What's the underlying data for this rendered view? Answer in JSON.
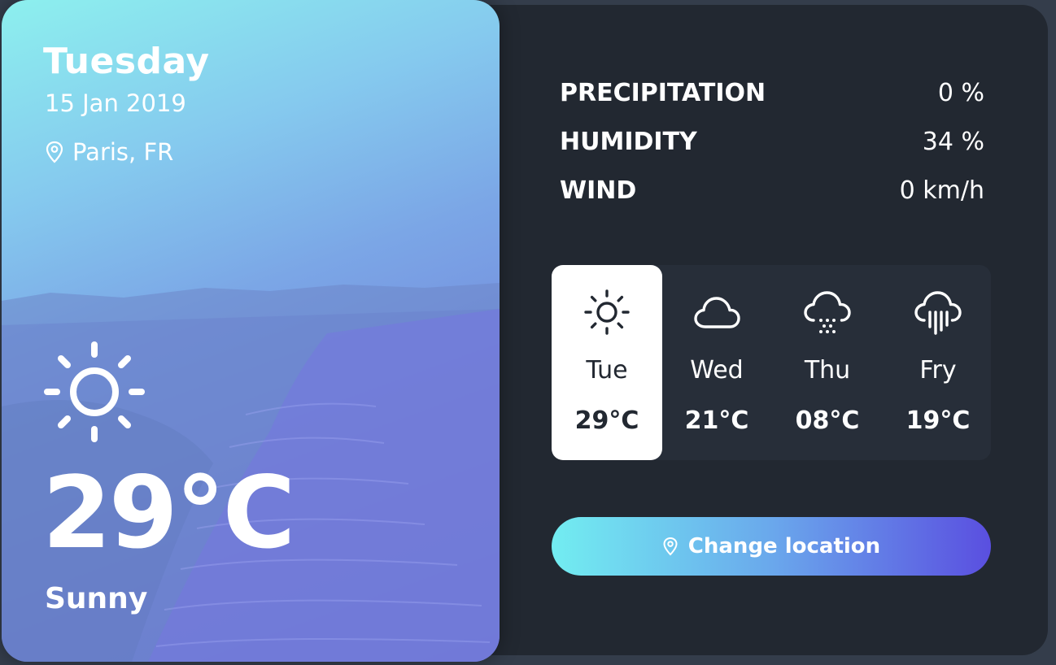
{
  "today": {
    "day": "Tuesday",
    "date": "15 Jan 2019",
    "location": "Paris, FR",
    "location_icon": "map-pin-icon",
    "temperature": "29°C",
    "condition": "Sunny",
    "condition_icon": "sun-icon"
  },
  "stats": [
    {
      "label": "PRECIPITATION",
      "value": "0 %"
    },
    {
      "label": "HUMIDITY",
      "value": "34 %"
    },
    {
      "label": "WIND",
      "value": "0 km/h"
    }
  ],
  "forecast": [
    {
      "day": "Tue",
      "temp": "29°C",
      "icon": "sun-icon",
      "active": true
    },
    {
      "day": "Wed",
      "temp": "21°C",
      "icon": "cloud-icon",
      "active": false
    },
    {
      "day": "Thu",
      "temp": "08°C",
      "icon": "cloud-snow-icon",
      "active": false
    },
    {
      "day": "Fry",
      "temp": "19°C",
      "icon": "cloud-rain-icon",
      "active": false
    }
  ],
  "change_location": {
    "label": "Change location",
    "icon": "map-pin-icon"
  },
  "colors": {
    "panel": "#222831",
    "background": "#343d4b",
    "gradient_start": "#72edf1",
    "gradient_end": "#5a4fe0"
  }
}
